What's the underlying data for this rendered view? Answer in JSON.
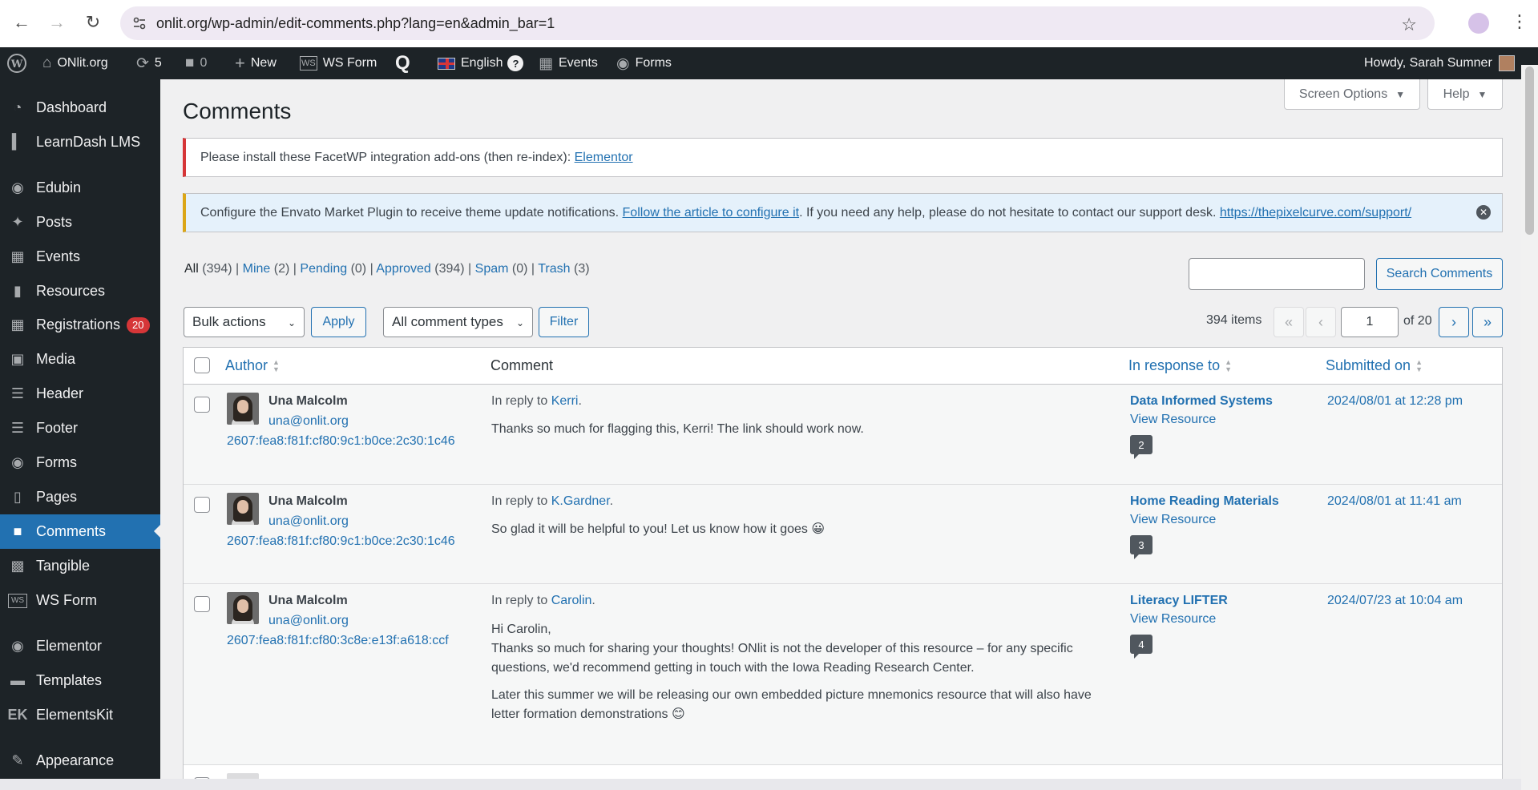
{
  "browser": {
    "url": "onlit.org/wp-admin/edit-comments.php?lang=en&admin_bar=1"
  },
  "adminbar": {
    "site_name": "ONlit.org",
    "updates_count": "5",
    "comments_count": "0",
    "new_label": "New",
    "wsform_label": "WS Form",
    "language_label": "English",
    "events_label": "Events",
    "forms_label": "Forms",
    "howdy": "Howdy, Sarah Sumner"
  },
  "sidebar": {
    "items": [
      {
        "label": "Dashboard",
        "icon": "dashboard-icon"
      },
      {
        "label": "LearnDash LMS",
        "icon": "learndash-icon"
      },
      {
        "label": "Edubin",
        "icon": "edubin-icon"
      },
      {
        "label": "Posts",
        "icon": "pin-icon"
      },
      {
        "label": "Events",
        "icon": "events-icon"
      },
      {
        "label": "Resources",
        "icon": "book-icon"
      },
      {
        "label": "Registrations",
        "icon": "calendar-icon",
        "badge": "20"
      },
      {
        "label": "Media",
        "icon": "media-icon"
      },
      {
        "label": "Header",
        "icon": "header-icon"
      },
      {
        "label": "Footer",
        "icon": "footer-icon"
      },
      {
        "label": "Forms",
        "icon": "forms-icon"
      },
      {
        "label": "Pages",
        "icon": "pages-icon"
      },
      {
        "label": "Comments",
        "icon": "comments-icon",
        "current": true
      },
      {
        "label": "Tangible",
        "icon": "tangible-icon"
      },
      {
        "label": "WS Form",
        "icon": "wsform-icon"
      },
      {
        "label": "Elementor",
        "icon": "elementor-icon"
      },
      {
        "label": "Templates",
        "icon": "folder-icon"
      },
      {
        "label": "ElementsKit",
        "icon": "elementskit-icon"
      },
      {
        "label": "Appearance",
        "icon": "brush-icon"
      }
    ]
  },
  "main": {
    "screen_options": "Screen Options",
    "help": "Help",
    "title": "Comments",
    "notice1": {
      "text": "Please install these FacetWP integration add-ons (then re-index): ",
      "link": "Elementor"
    },
    "notice2": {
      "text1": "Configure the Envato Market Plugin to receive theme update notifications. ",
      "link1": "Follow the article to configure it",
      "text2": ". If you need any help, please do not hesitate to contact our support desk. ",
      "link2": "https://thepixelcurve.com/support/"
    },
    "filters": {
      "all": "All",
      "all_count": "(394)",
      "mine": "Mine",
      "mine_count": "(2)",
      "pending": "Pending",
      "pending_count": "(0)",
      "approved": "Approved",
      "approved_count": "(394)",
      "spam": "Spam",
      "spam_count": "(0)",
      "trash": "Trash",
      "trash_count": "(3)"
    },
    "search_button": "Search Comments",
    "bulk_actions": "Bulk actions",
    "apply": "Apply",
    "comment_types": "All comment types",
    "filter": "Filter",
    "items_count": "394 items",
    "current_page": "1",
    "of_pages": "of 20",
    "columns": {
      "author": "Author",
      "comment": "Comment",
      "in_response_to": "In response to",
      "submitted_on": "Submitted on"
    },
    "rows": [
      {
        "author": "Una Malcolm",
        "email": "una@onlit.org",
        "ip": "2607:fea8:f81f:cf80:9c1:b0ce:2c30:1c46",
        "reply_prefix": "In reply to ",
        "reply_to": "Kerri",
        "comment_lines": [
          "Thanks so much for flagging this, Kerri! The link should work now."
        ],
        "response_title": "Data Informed Systems",
        "view": "View Resource",
        "count": "2",
        "submitted": "2024/08/01 at 12:28 pm"
      },
      {
        "author": "Una Malcolm",
        "email": "una@onlit.org",
        "ip": "2607:fea8:f81f:cf80:9c1:b0ce:2c30:1c46",
        "reply_prefix": "In reply to ",
        "reply_to": "K.Gardner",
        "comment_lines": [
          "So glad it will be helpful to you! Let us know how it goes 😀"
        ],
        "response_title": "Home Reading Materials",
        "view": "View Resource",
        "count": "3",
        "submitted": "2024/08/01 at 11:41 am"
      },
      {
        "author": "Una Malcolm",
        "email": "una@onlit.org",
        "ip": "2607:fea8:f81f:cf80:3c8e:e13f:a618:ccf",
        "reply_prefix": "In reply to ",
        "reply_to": "Carolin",
        "comment_lines": [
          "Hi Carolin,",
          "Thanks so much for sharing your thoughts! ONlit is not the developer of this resource – for any specific",
          "questions, we'd recommend getting in touch with the Iowa Reading Research Center.",
          "Later this summer we will be releasing our own embedded picture mnemonics resource that will also have",
          "letter formation demonstrations 😊"
        ],
        "response_title": "Literacy LIFTER",
        "view": "View Resource",
        "count": "4",
        "submitted": "2024/07/23 at 10:04 am"
      }
    ]
  }
}
